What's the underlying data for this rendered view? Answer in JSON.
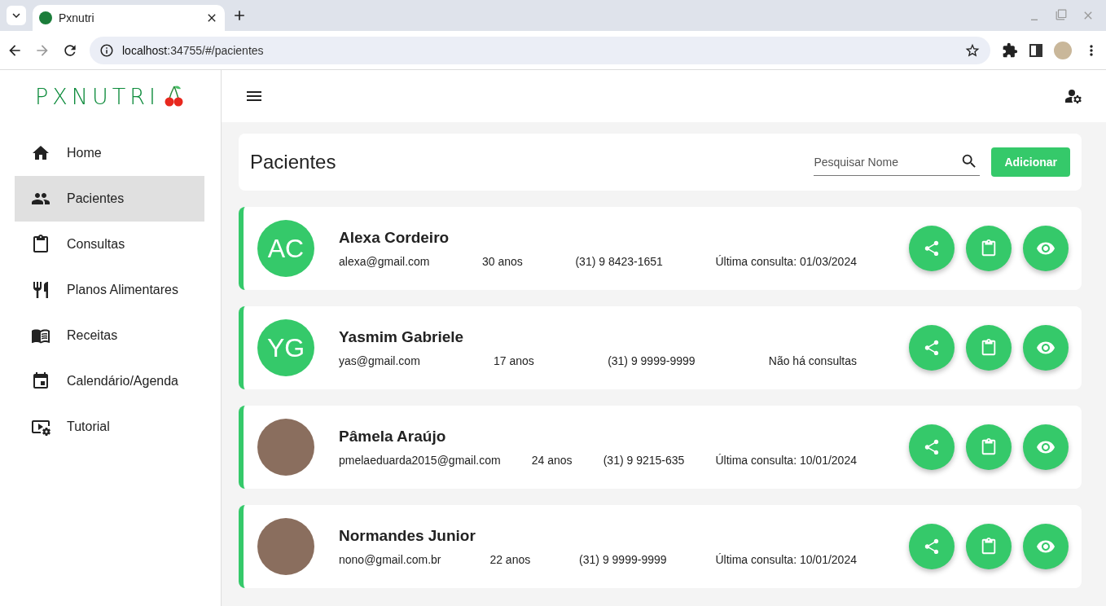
{
  "browser": {
    "tab_title": "Pxnutri",
    "url_host": "localhost",
    "url_path": ":34755/#/pacientes"
  },
  "sidebar": {
    "logo": "PXNUTRI",
    "items": [
      {
        "label": "Home",
        "selected": false
      },
      {
        "label": "Pacientes",
        "selected": true
      },
      {
        "label": "Consultas",
        "selected": false
      },
      {
        "label": "Planos Alimentares",
        "selected": false
      },
      {
        "label": "Receitas",
        "selected": false
      },
      {
        "label": "Calendário/Agenda",
        "selected": false
      },
      {
        "label": "Tutorial",
        "selected": false
      }
    ]
  },
  "page": {
    "title": "Pacientes",
    "search": {
      "placeholder": "Pesquisar Nome"
    },
    "add_button": "Adicionar"
  },
  "patients": [
    {
      "kind": "initials",
      "initials": "AC",
      "name": "Alexa Cordeiro",
      "email": "alexa@gmail.com",
      "age": "30 anos",
      "phone": "(31) 9 8423-1651",
      "last_visit": "Última consulta: 01/03/2024"
    },
    {
      "kind": "initials",
      "initials": "YG",
      "name": "Yasmim Gabriele",
      "email": "yas@gmail.com",
      "age": "17 anos",
      "phone": "(31) 9 9999-9999",
      "last_visit": "Não há consultas"
    },
    {
      "kind": "photo",
      "name": "Pâmela Araújo",
      "email": "pmelaeduarda2015@gmail.com",
      "age": "24 anos",
      "phone": "(31) 9 9215-635",
      "last_visit": "Última consulta: 10/01/2024"
    },
    {
      "kind": "photo",
      "name": "Normandes Junior",
      "email": "nono@gmail.com.br",
      "age": "22 anos",
      "phone": "(31) 9 9999-9999",
      "last_visit": "Última consulta: 10/01/2024"
    }
  ]
}
